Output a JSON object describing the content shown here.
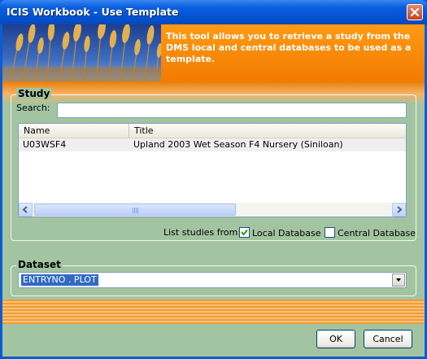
{
  "window": {
    "title": "ICIS Workbook - Use Template"
  },
  "banner": {
    "text": "This tool allows you to retrieve a study from the DMS local and central databases to be used as a template."
  },
  "study": {
    "label": "Study",
    "search_label": "Search:",
    "search_value": "",
    "columns": [
      "Name",
      "Title"
    ],
    "rows": [
      {
        "name": "U03WSF4",
        "title": "Upland 2003 Wet Season F4 Nursery (Siniloan)"
      }
    ],
    "list_from_label": "List studies from:",
    "local_label": "Local Database",
    "local_checked": true,
    "central_label": "Central Database",
    "central_checked": false
  },
  "dataset": {
    "label": "Dataset",
    "selected": "ENTRYNO . PLOT"
  },
  "buttons": {
    "ok": "OK",
    "cancel": "Cancel"
  },
  "colors": {
    "title_bar": "#0a5fe0",
    "banner_orange": "#f27b00",
    "client_bg": "#a3c4a1",
    "selection": "#316ac5"
  }
}
